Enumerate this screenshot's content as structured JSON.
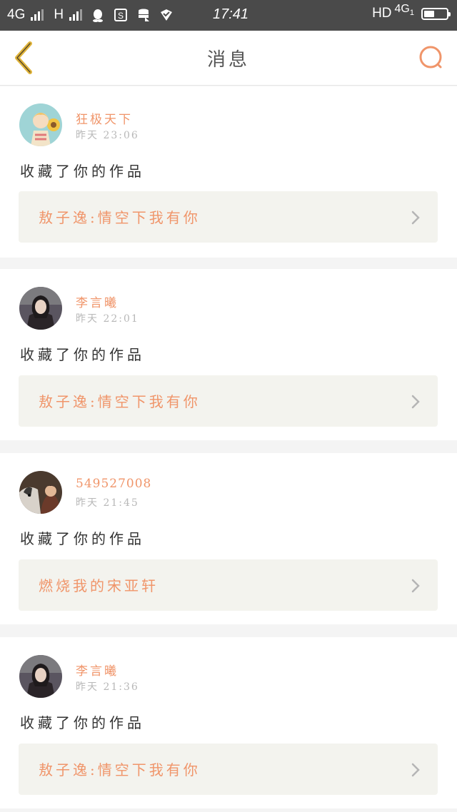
{
  "status_bar": {
    "net1": "4G",
    "net2": "H",
    "time": "17:41",
    "hd": "HD",
    "net3": "4G",
    "net3_sub": "1",
    "battery_level": 0.45
  },
  "header": {
    "title": "消息",
    "back_icon": "chevron-left-icon",
    "search_icon": "search-icon",
    "accent_color": "#f0956a"
  },
  "notifications": [
    {
      "username": "狂极天下",
      "time": "昨天 23:06",
      "action": "收藏了你的作品",
      "work_title": "敖子逸:情空下我有你"
    },
    {
      "username": "李言曦",
      "time": "昨天 22:01",
      "action": "收藏了你的作品",
      "work_title": "敖子逸:情空下我有你"
    },
    {
      "username": "549527008",
      "time": "昨天 21:45",
      "action": "收藏了你的作品",
      "work_title": "燃烧我的宋亚轩"
    },
    {
      "username": "李言曦",
      "time": "昨天 21:36",
      "action": "收藏了你的作品",
      "work_title": "敖子逸:情空下我有你"
    }
  ]
}
